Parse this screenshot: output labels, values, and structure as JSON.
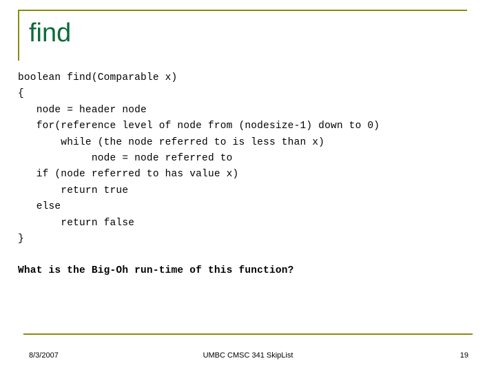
{
  "slide": {
    "title": "find",
    "code": "boolean find(Comparable x)\n{\n   node = header node\n   for(reference level of node from (nodesize-1) down to 0)\n       while (the node referred to is less than x)\n            node = node referred to\n   if (node referred to has value x)\n       return true\n   else\n       return false\n}",
    "question": "What is the Big-Oh run-time of this function?",
    "footer": {
      "date": "8/3/2007",
      "center": "UMBC CMSC 341 SkipList",
      "page": "19"
    },
    "colors": {
      "accent_rule": "#8a8a10",
      "title_text": "#0b6b3a",
      "body_text": "#000000"
    }
  }
}
